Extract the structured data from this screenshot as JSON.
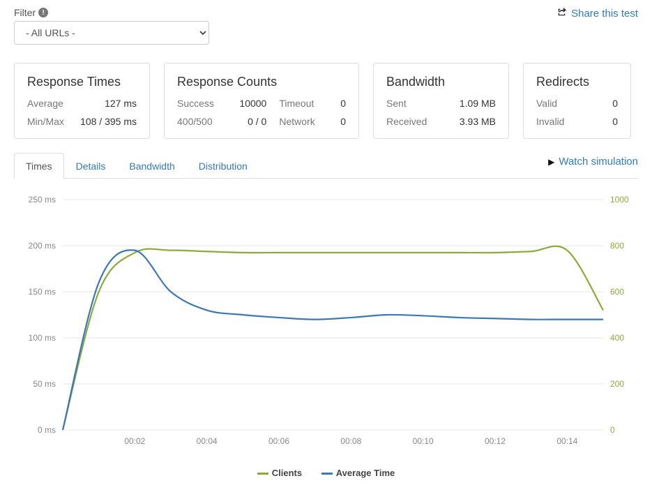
{
  "top": {
    "filter_label": "Filter",
    "filter_selected": "- All URLs -",
    "share_label": "Share this test"
  },
  "cards": {
    "response_times": {
      "title": "Response Times",
      "rows": [
        {
          "k": "Average",
          "v": "127 ms"
        },
        {
          "k": "Min/Max",
          "v": "108 / 395 ms"
        }
      ]
    },
    "response_counts": {
      "title": "Response Counts",
      "rows": [
        {
          "k1": "Success",
          "v1": "10000",
          "k2": "Timeout",
          "v2": "0"
        },
        {
          "k1": "400/500",
          "v1": "0 / 0",
          "k2": "Network",
          "v2": "0"
        }
      ]
    },
    "bandwidth": {
      "title": "Bandwidth",
      "rows": [
        {
          "k": "Sent",
          "v": "1.09 MB"
        },
        {
          "k": "Received",
          "v": "3.93 MB"
        }
      ]
    },
    "redirects": {
      "title": "Redirects",
      "rows": [
        {
          "k": "Valid",
          "v": "0"
        },
        {
          "k": "Invalid",
          "v": "0"
        }
      ]
    }
  },
  "tabs": {
    "items": [
      "Times",
      "Details",
      "Bandwidth",
      "Distribution"
    ],
    "active": 0
  },
  "watch_label": "Watch simulation",
  "legend": {
    "clients": "Clients",
    "avg": "Average Time"
  },
  "colors": {
    "clients": "#8aab3a",
    "avg": "#3b78b5",
    "link": "#337ab7"
  },
  "chart_data": {
    "type": "line",
    "xlabel": "",
    "ylabel_left": "ms",
    "ylabel_right": "clients",
    "x_ticks": [
      "00:02",
      "00:04",
      "00:06",
      "00:08",
      "00:10",
      "00:12",
      "00:14"
    ],
    "y_left_ticks": [
      0,
      50,
      100,
      150,
      200,
      250
    ],
    "y_right_ticks": [
      0,
      200,
      400,
      600,
      800,
      1000
    ],
    "ylim_left": [
      0,
      250
    ],
    "ylim_right": [
      0,
      1000
    ],
    "x": [
      0,
      1,
      2,
      3,
      4,
      5,
      6,
      7,
      8,
      9,
      10,
      11,
      12,
      13,
      14,
      15
    ],
    "series": [
      {
        "name": "Clients",
        "axis": "right",
        "values": [
          0,
          600,
          770,
          780,
          775,
          770,
          770,
          770,
          770,
          770,
          770,
          770,
          770,
          775,
          780,
          520
        ]
      },
      {
        "name": "Average Time",
        "axis": "left",
        "values": [
          0,
          160,
          195,
          150,
          130,
          125,
          122,
          120,
          122,
          125,
          124,
          122,
          121,
          120,
          120,
          120
        ]
      }
    ]
  }
}
